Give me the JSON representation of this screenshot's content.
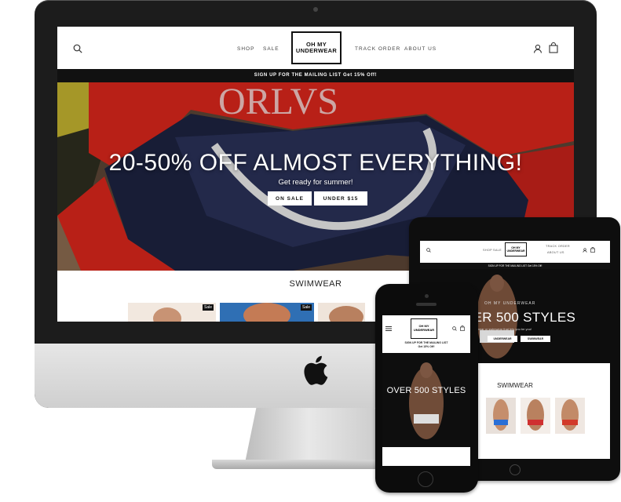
{
  "desktop": {
    "nav": {
      "shop": "SHOP",
      "sale": "SALE",
      "track_order": "TRACK ORDER",
      "about_us": "ABOUT US"
    },
    "logo": {
      "line1": "OH MY",
      "line2": "UNDERWEAR"
    },
    "announcement": "SIGN UP FOR THE MAILING LIST Get 15% Off!",
    "hero": {
      "title": "20-50% OFF ALMOST EVERYTHING!",
      "subtitle": "Get ready for summer!",
      "button_sale": "ON SALE",
      "button_under": "UNDER $15",
      "print_text": "ORLVS"
    },
    "section_title": "SWIMWEAR",
    "badge": "Sale"
  },
  "tablet": {
    "nav": {
      "shop": "SHOP",
      "sale": "SALE",
      "track_order": "TRACK ORDER",
      "about_us": "ABOUT US"
    },
    "logo": {
      "line1": "OH MY",
      "line2": "UNDERWEAR"
    },
    "announcement": "SIGN UP FOR THE MAILING LIST Get 15% Off!",
    "hero": {
      "brand": "OH MY UNDERWEAR",
      "title": "VER 500 STYLES",
      "subtitle": "the underwear or swimwear that lets you be you!",
      "button_underwear": "UNDERWEAR",
      "button_swimwear": "SWIMWEAR"
    },
    "section_title": "SWIMWEAR"
  },
  "phone": {
    "logo": {
      "line1": "OH MY",
      "line2": "UNDERWEAR"
    },
    "announcement_line1": "SIGN UP FOR THE MAILING LIST",
    "announcement_line2": "Get 15% Off!",
    "hero_title": "OVER 500 STYLES"
  },
  "colors": {
    "hero_red": "#d9261c",
    "black": "#111111",
    "screen_white": "#ffffff"
  }
}
